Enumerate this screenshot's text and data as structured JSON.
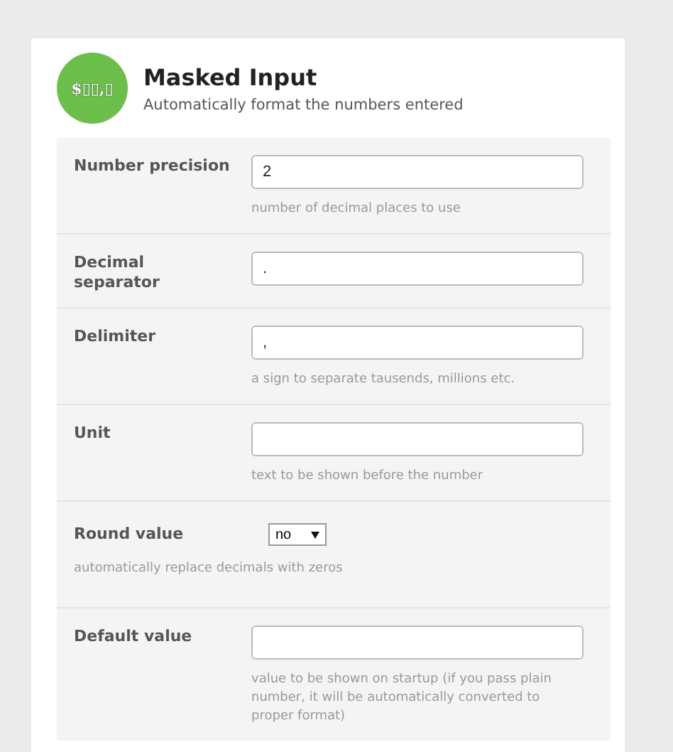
{
  "header": {
    "logo_text": "$▯▯,▯",
    "title": "Masked Input",
    "subtitle": "Automatically format the numbers entered"
  },
  "fields": [
    {
      "kind": "input",
      "label": "Number precision",
      "value": "2",
      "hint": "number of decimal places to use"
    },
    {
      "kind": "input",
      "label": "Decimal separator",
      "value": "."
    },
    {
      "kind": "input",
      "label": "Delimiter",
      "value": ",",
      "hint": "a sign to separate tausends, millions etc."
    },
    {
      "kind": "input",
      "label": "Unit",
      "hint": "text to be shown before the number"
    },
    {
      "kind": "select",
      "label": "Round value",
      "value": "no",
      "hint": "automatically replace decimals with zeros"
    },
    {
      "kind": "input",
      "label": "Default value",
      "hint": "value to be shown on startup (if you pass plain number, it will be automatically converted to proper format)"
    }
  ]
}
